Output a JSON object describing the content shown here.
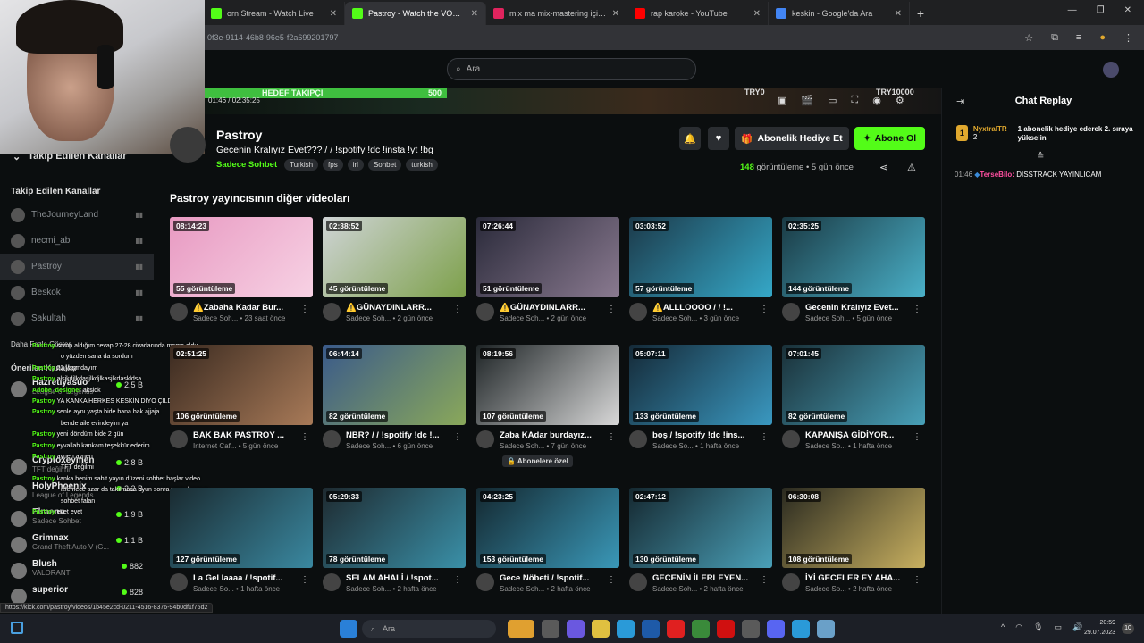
{
  "browser": {
    "tabs": [
      {
        "label": "orn Stream - Watch Live",
        "color": "#53fc18",
        "active": false
      },
      {
        "label": "Pastroy - Watch the VOD on Ki",
        "color": "#53fc18",
        "active": true
      },
      {
        "label": "mix ma mix-mastering içinde",
        "color": "#e0245e",
        "active": false
      },
      {
        "label": "rap karoke - YouTube",
        "color": "#ff0000",
        "active": false
      },
      {
        "label": "keskin - Google'da Ara",
        "color": "#4285f4",
        "active": false
      }
    ],
    "url": "0f3e-9114-46b8-96e5-f2a699201797",
    "status_url": "https://kick.com/pastroy/videos/1b45e2cd-0211-4516-8376-94b0df1f75d2"
  },
  "header": {
    "search_placeholder": "Ara"
  },
  "player": {
    "goal_label": "HEDEF TAKIPÇI",
    "goal_value": "500",
    "time_current": "01:46",
    "time_total": "02:35:25",
    "try0": "TRY0",
    "try10000": "TRY10000"
  },
  "sidebar": {
    "following_collapsed": "Takip Edilen Kanallar",
    "following_heading": "Takip Edilen Kanallar",
    "following": [
      {
        "name": "TheJourneyLand",
        "active": false
      },
      {
        "name": "necmi_abi",
        "active": false
      },
      {
        "name": "Pastroy",
        "active": true
      },
      {
        "name": "Beskok",
        "active": false
      },
      {
        "name": "Sakultah",
        "active": false
      }
    ],
    "show_more": "Daha Fazla Göster",
    "recommended_heading": "Önerilen Kanallar",
    "recommended": [
      {
        "name": "Hazretiyasuo",
        "category": "League of Legends",
        "viewers": "2,5 B"
      },
      {
        "name": "",
        "category": "",
        "viewers": ""
      },
      {
        "name": "",
        "category": "",
        "viewers": ""
      },
      {
        "name": "Cryptoxeymen",
        "category": "TFT değilmi",
        "viewers": "2,8 B"
      },
      {
        "name": "HolyPhoenix",
        "category": "League of Legends",
        "viewers": "2,2 B"
      },
      {
        "name": "Elraenn",
        "category": "Sadece Sohbet",
        "viewers": "1,9 B"
      },
      {
        "name": "Grimnax",
        "category": "Grand Theft Auto V (G...",
        "viewers": "1,1 B"
      },
      {
        "name": "Blush",
        "category": "VALORANT",
        "viewers": "882"
      },
      {
        "name": "superior",
        "category": "",
        "viewers": "828"
      }
    ]
  },
  "chat_overlay": [
    {
      "user": "Pastroy",
      "text": "sorup aldığım cevap 27-28 civarlarında meme oldu"
    },
    {
      "user": "",
      "text": "o yüzden sana da sordum"
    },
    {
      "user": "Pastroy",
      "text": "22 yaşındayım"
    },
    {
      "user": "Pastroy",
      "text": "alsjkdjlkdasjlkdjlkasjlkdaskldsa"
    },
    {
      "user": "Adobe_designer",
      "text": "aksldk"
    },
    {
      "user": "Pastroy",
      "text": "YA KANKA HERKES KESKİN DİYO ÇILDIRCAM AW"
    },
    {
      "user": "Pastroy",
      "text": "senle aynı yaşta bide bana bak ajjaja"
    },
    {
      "user": "",
      "text": "bende aile evindeyim ya"
    },
    {
      "user": "Pastroy",
      "text": "yeni döndüm bide 2 gün"
    },
    {
      "user": "Pastroy",
      "text": "eyvallah kankam teşekkür ederim"
    },
    {
      "user": "Pastroy",
      "text": "aynen aynen"
    },
    {
      "user": "",
      "text": "TFT değilmi"
    },
    {
      "user": "Pastroy",
      "text": "kanka benim sabit yayın düzeni sohbet başlar video"
    },
    {
      "user": "",
      "text": "izlemece azar da takılmaca oyun sonra yayın kapanır"
    },
    {
      "user": "",
      "text": "sohbet falan"
    },
    {
      "user": "Pastroy",
      "text": "evet evet"
    }
  ],
  "channel": {
    "name": "Pastroy",
    "title": "Gecenin Kralıyız Evet??? / / !spotify !dc !insta !yt !bg",
    "category": "Sadece Sohbet",
    "tags": [
      "Turkish",
      "fps",
      "irl",
      "Sohbet",
      "turkish"
    ],
    "gift_label": "Abonelik Hediye Et",
    "follow_label": "Abone Ol",
    "view_count": "148",
    "view_word": "görüntüleme",
    "posted": "5 gün önce"
  },
  "section_title": "Pastroy yayıncısının diğer videoları",
  "videos": [
    {
      "duration": "08:14:23",
      "views": "55 görüntüleme",
      "title": "⚠️Zabaha Kadar Bur...",
      "category": "Sadece Soh...",
      "age": "23 saat önce",
      "c1": "#e89ac2",
      "c2": "#f7d2e4"
    },
    {
      "duration": "02:38:52",
      "views": "45 görüntüleme",
      "title": "⚠️GÜNAYDINLARR...",
      "category": "Sadece Soh...",
      "age": "2 gün önce",
      "c1": "#cfd4d6",
      "c2": "#7da04a"
    },
    {
      "duration": "07:26:44",
      "views": "51 görüntüleme",
      "title": "⚠️GÜNAYDINLARR...",
      "category": "Sadece Soh...",
      "age": "2 gün önce",
      "c1": "#2a2a3a",
      "c2": "#8a7a90"
    },
    {
      "duration": "03:03:52",
      "views": "57 görüntüleme",
      "title": "⚠️ALLLOOOO / / !...",
      "category": "Sadece Soh...",
      "age": "3 gün önce",
      "c1": "#1c3a4a",
      "c2": "#35a8c8"
    },
    {
      "duration": "02:35:25",
      "views": "144 görüntüleme",
      "title": "Gecenin Kralıyız Evet...",
      "category": "Sadece Soh...",
      "age": "5 gün önce",
      "c1": "#1a3a44",
      "c2": "#4ab0c8"
    },
    {
      "duration": "02:51:25",
      "views": "106 görüntüleme",
      "title": "BAK BAK PASTROY ...",
      "category": "Internet Caf...",
      "age": "5 gün önce",
      "c1": "#3a2a20",
      "c2": "#a87a58"
    },
    {
      "duration": "06:44:14",
      "views": "82 görüntüleme",
      "title": "NBR? / / !spotify !dc !...",
      "category": "Sadece Soh...",
      "age": "6 gün önce",
      "c1": "#3a5a8a",
      "c2": "#8aa85a"
    },
    {
      "duration": "08:19:56",
      "views": "107 görüntüleme",
      "title": "Zaba KAdar burdayız...",
      "category": "Sadece Soh...",
      "age": "7 gün önce",
      "c1": "#1e2426",
      "c2": "#d8d8d8"
    },
    {
      "duration": "05:07:11",
      "views": "133 görüntüleme",
      "title": "boş / !spotify !dc !ins...",
      "category": "Sadece So...",
      "age": "1 hafta önce",
      "c1": "#152a38",
      "c2": "#3a98c0"
    },
    {
      "duration": "07:01:45",
      "views": "82 görüntüleme",
      "title": "KAPANIŞA GİDİYOR...",
      "category": "Sadece So...",
      "age": "1 hafta önce",
      "c1": "#1a3038",
      "c2": "#48a0b8"
    },
    {
      "duration": "",
      "views": "127 görüntüleme",
      "title": "La Gel laaaa / !spotif...",
      "category": "Sadece So...",
      "age": "1 hafta önce",
      "c1": "#1a2a30",
      "c2": "#3a88a0"
    },
    {
      "duration": "05:29:33",
      "views": "78 görüntüleme",
      "title": "SELAM AHALİ / !spot...",
      "category": "Sadece Soh...",
      "age": "2 hafta önce",
      "c1": "#1e2a30",
      "c2": "#3a90a8"
    },
    {
      "duration": "04:23:25",
      "views": "153 görüntüleme",
      "title": "Gece Nöbeti / !spotif...",
      "category": "Sadece Soh...",
      "age": "2 hafta önce",
      "c1": "#142830",
      "c2": "#3a98b8"
    },
    {
      "duration": "02:47:12",
      "views": "130 görüntüleme",
      "title": "GECENİN İLERLEYEN...",
      "category": "Sadece Soh...",
      "age": "2 hafta önce",
      "c1": "#152830",
      "c2": "#4aa0b8"
    },
    {
      "duration": "06:30:08",
      "views": "108 görüntüleme",
      "title": "İYİ GECELER EY AHA...",
      "category": "Sadece So...",
      "age": "2 hafta önce",
      "c1": "#2a2a20",
      "c2": "#c8b060"
    }
  ],
  "subscribers_only": "Abonelere özel",
  "chat": {
    "title": "Chat Replay",
    "pinned_user": "NyxtralTR",
    "pinned_count": "2",
    "pinned_text": "1 abonelik hediye ederek 2. sıraya yükselin",
    "messages": [
      {
        "time": "01:46",
        "user": "TerseBilo:",
        "text": "DİSSTRACK YAYINLICAM"
      }
    ]
  },
  "taskbar": {
    "search": "Ara",
    "time": "20:59",
    "date": "29.07.2023",
    "notif": "10"
  }
}
